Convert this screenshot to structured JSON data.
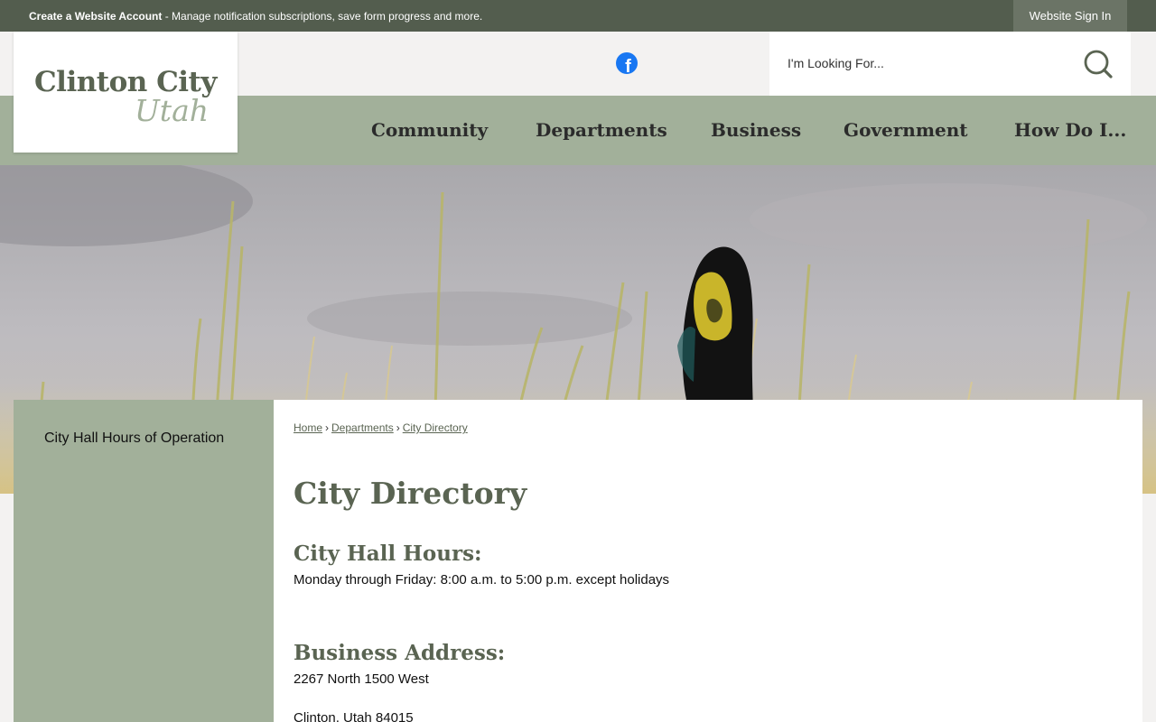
{
  "topbar": {
    "create_account": "Create a Website Account",
    "message": " - Manage notification subscriptions, save form progress and more.",
    "signin": "Website Sign In"
  },
  "logo": {
    "line1": "Clinton City",
    "line2": "Utah"
  },
  "social": {
    "facebook_icon": "facebook-icon"
  },
  "search": {
    "placeholder": "I'm Looking For...",
    "icon": "search-icon"
  },
  "nav": {
    "items": [
      "Community",
      "Departments",
      "Business",
      "Government",
      "How Do I..."
    ]
  },
  "sidebar": {
    "items": [
      "City Hall Hours of Operation"
    ]
  },
  "breadcrumb": {
    "home": "Home",
    "departments": "Departments",
    "current": "City Directory",
    "separator": "›"
  },
  "main": {
    "title": "City Directory",
    "hours_heading": "City Hall Hours:",
    "hours_text": "Monday through Friday: 8:00 a.m. to 5:00 p.m. except holidays",
    "address_heading": "Business Address:",
    "address_line1": "2267 North 1500 West",
    "address_line2": "Clinton, Utah 84015"
  },
  "colors": {
    "topbar": "#535d4e",
    "nav": "#a2b09a",
    "heading": "#5a6452",
    "facebook": "#1877f2"
  }
}
